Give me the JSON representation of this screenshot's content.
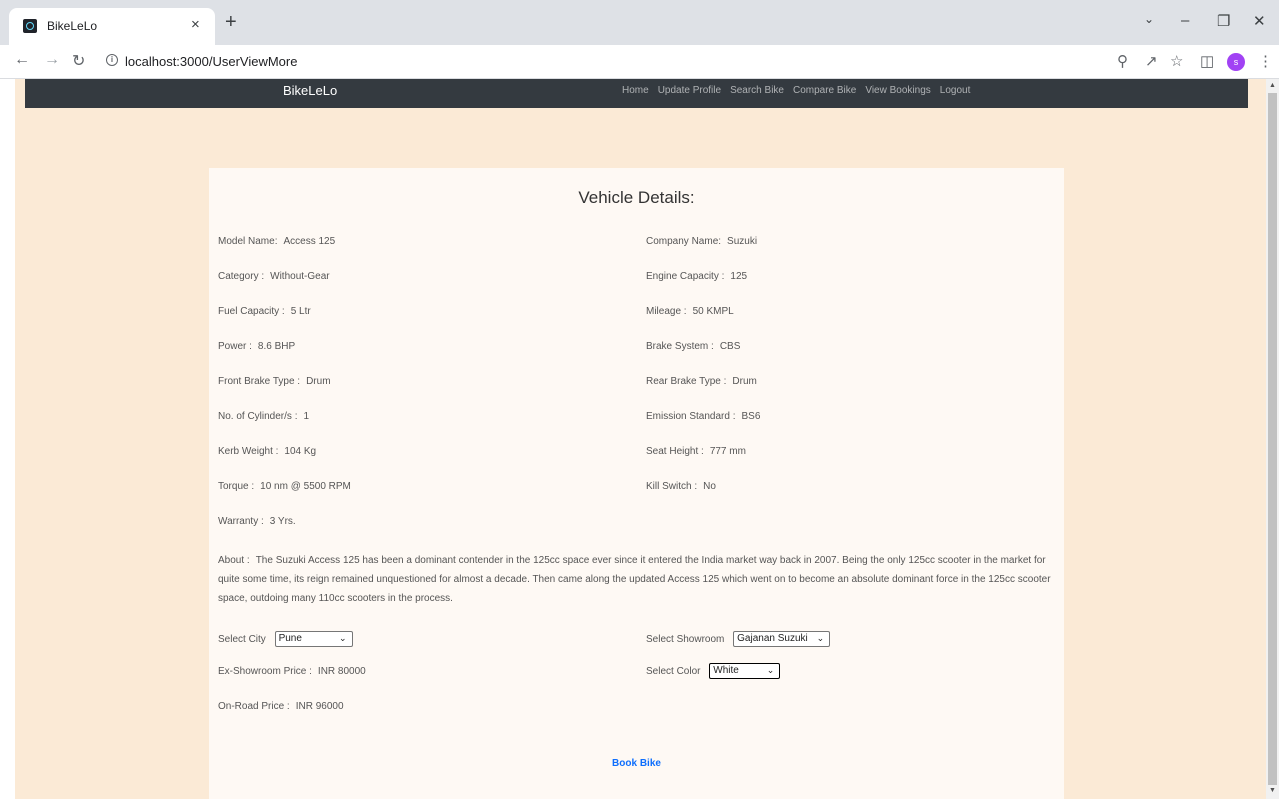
{
  "browser": {
    "tab_title": "BikeLeLo",
    "tab_close": "×",
    "new_tab": "+",
    "url": "localhost:3000/UserViewMore",
    "profile_initial": "s"
  },
  "navbar": {
    "brand": "BikeLeLo",
    "links": [
      "Home",
      "Update Profile",
      "Search Bike",
      "Compare Bike",
      "View Bookings",
      "Logout"
    ]
  },
  "details": {
    "title": "Vehicle Details:",
    "left": [
      {
        "label": "Model Name:",
        "value": "Access 125"
      },
      {
        "label": "Category :",
        "value": "Without-Gear"
      },
      {
        "label": "Fuel Capacity :",
        "value": "5 Ltr"
      },
      {
        "label": "Power :",
        "value": "8.6 BHP"
      },
      {
        "label": "Front Brake Type :",
        "value": "Drum"
      },
      {
        "label": "No. of Cylinder/s :",
        "value": "1"
      },
      {
        "label": "Kerb Weight :",
        "value": "104 Kg"
      },
      {
        "label": "Torque :",
        "value": "10 nm @ 5500 RPM"
      },
      {
        "label": "Warranty :",
        "value": "3 Yrs."
      }
    ],
    "right": [
      {
        "label": "Company Name:",
        "value": "Suzuki"
      },
      {
        "label": "Engine Capacity :",
        "value": "125"
      },
      {
        "label": "Mileage :",
        "value": "50 KMPL"
      },
      {
        "label": "Brake System :",
        "value": "CBS"
      },
      {
        "label": "Rear Brake Type :",
        "value": "Drum"
      },
      {
        "label": "Emission Standard :",
        "value": "BS6"
      },
      {
        "label": "Seat Height :",
        "value": "777 mm"
      },
      {
        "label": "Kill Switch :",
        "value": "No"
      }
    ],
    "about_label": "About :",
    "about_text": "The Suzuki Access 125 has been a dominant contender in the 125cc space ever since it entered the India market way back in 2007. Being the only 125cc scooter in the market for quite some time, its reign remained unquestioned for almost a decade. Then came along the updated Access 125 which went on to become an absolute dominant force in the 125cc scooter space, outdoing many 110cc scooters in the process."
  },
  "booking": {
    "city_label": "Select City",
    "city_value": "Pune",
    "showroom_label": "Select Showroom",
    "showroom_value": "Gajanan Suzuki",
    "ex_label": "Ex-Showroom Price :",
    "ex_value": "INR 80000",
    "color_label": "Select Color",
    "color_value": "White",
    "onroad_label": "On-Road Price :",
    "onroad_value": "INR 96000",
    "book_label": "Book Bike"
  }
}
